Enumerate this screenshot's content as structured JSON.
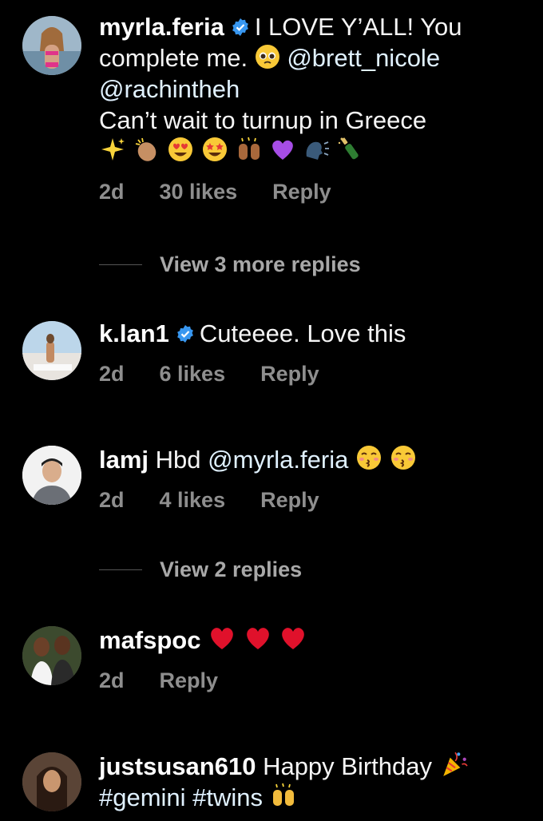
{
  "comments": [
    {
      "username": "myrla.feria",
      "verified": true,
      "text_line1": "I LOVE Y’ALL! You",
      "text_line2": "complete me.",
      "mention1": "@brett_nicole",
      "mention2": "@rachintheh",
      "text_line4": "Can’t wait to turnup in Greece",
      "time": "2d",
      "likes": "30 likes",
      "reply": "Reply",
      "view_more": "View 3 more replies",
      "emojis": [
        "pleading-face",
        "sparkles",
        "clapping-hands",
        "heart-eyes",
        "star-struck",
        "raising-hands",
        "purple-heart",
        "speaking-head",
        "champagne"
      ]
    },
    {
      "username": "k.lan1",
      "verified": true,
      "text": "Cuteeee. Love this",
      "time": "2d",
      "likes": "6 likes",
      "reply": "Reply"
    },
    {
      "username": "lamj",
      "verified": false,
      "text": "Hbd",
      "mention": "@myrla.feria",
      "time": "2d",
      "likes": "4 likes",
      "reply": "Reply",
      "view_more": "View 2 replies",
      "emojis": [
        "kissing-face",
        "kissing-face"
      ]
    },
    {
      "username": "mafspoc",
      "verified": false,
      "text": "",
      "time": "2d",
      "reply": "Reply",
      "emojis": [
        "red-heart",
        "red-heart",
        "red-heart"
      ]
    },
    {
      "username": "justsusan610",
      "verified": false,
      "text": "Happy Birthday",
      "hashtags": "#gemini #twins",
      "emojis": [
        "party-popper",
        "raising-hands"
      ]
    }
  ],
  "colors": {
    "background": "#000000",
    "meta_text": "#8e8e8e",
    "mention": "#e0f1ff",
    "verified_badge": "#3897f0"
  }
}
